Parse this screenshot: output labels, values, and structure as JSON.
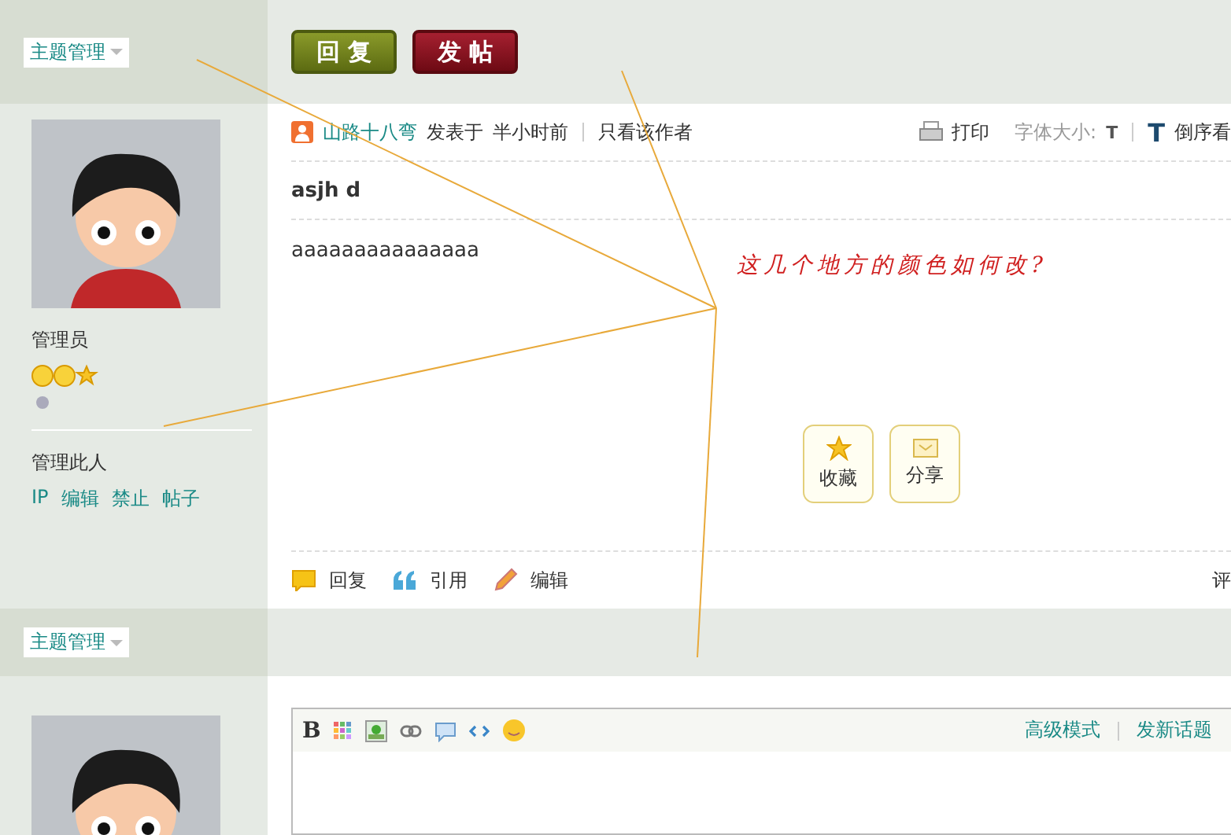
{
  "top_bar": {
    "manage_select": "主题管理",
    "buttons": [
      {
        "kind": "reply",
        "label": "回 复"
      },
      {
        "kind": "post",
        "label": "发 帖"
      }
    ]
  },
  "post": {
    "author": {
      "role": "管理员",
      "manage_title": "管理此人",
      "manage_links": [
        "IP",
        "编辑",
        "禁止",
        "帖子"
      ]
    },
    "meta": {
      "author_name": "山路十八弯",
      "posted_label": "发表于",
      "time": "半小时前",
      "only_author": "只看该作者",
      "print": "打印",
      "font_size_label": "字体大小:",
      "font_small": "T",
      "font_large": "T",
      "reverse": "倒序看"
    },
    "title": "asjh d",
    "content": "aaaaaaaaaaaaaaa",
    "share_buttons": [
      {
        "kind": "favorite",
        "label": "收藏"
      },
      {
        "kind": "share",
        "label": "分享"
      }
    ],
    "actions": [
      {
        "kind": "reply",
        "label": "回复"
      },
      {
        "kind": "quote",
        "label": "引用"
      },
      {
        "kind": "edit",
        "label": "编辑"
      }
    ],
    "rate": "评"
  },
  "second_bar": {
    "manage_select": "主题管理"
  },
  "editor": {
    "tools": [
      {
        "kind": "bold",
        "label": "B"
      },
      {
        "kind": "color"
      },
      {
        "kind": "image"
      },
      {
        "kind": "link"
      },
      {
        "kind": "quote"
      },
      {
        "kind": "code"
      },
      {
        "kind": "smiley"
      }
    ],
    "advanced": "高级模式",
    "new_topic": "发新话题"
  },
  "annotation": {
    "note": "这几个地方的颜色如何改?"
  }
}
